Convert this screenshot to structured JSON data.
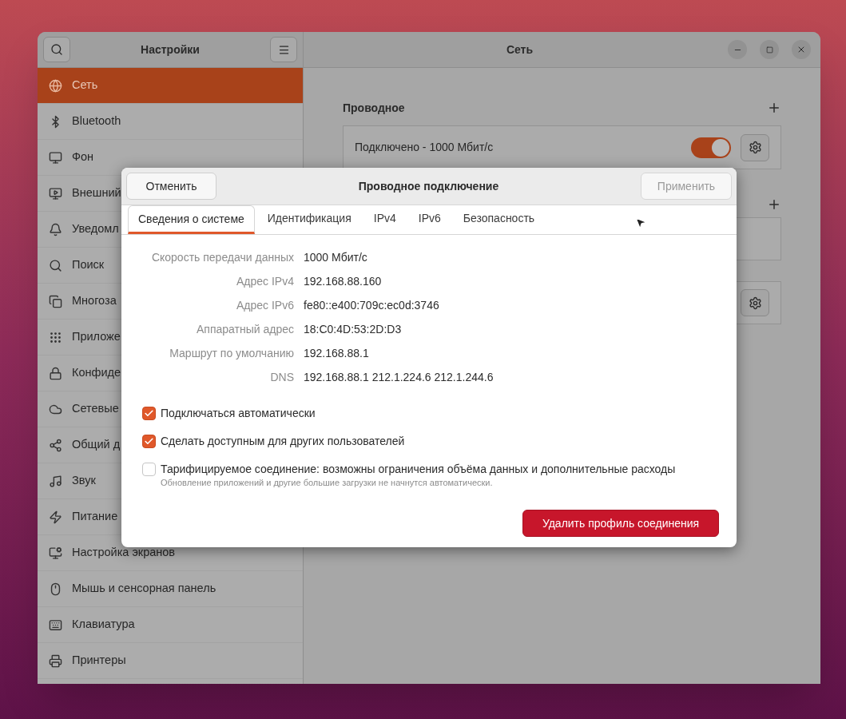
{
  "window": {
    "title": "Настройки",
    "panel_title": "Сеть"
  },
  "sidebar": {
    "items": [
      {
        "label": "Сеть",
        "selected": true
      },
      {
        "label": "Bluetooth",
        "selected": false
      },
      {
        "label": "Фон",
        "selected": false
      },
      {
        "label": "Внешний",
        "selected": false
      },
      {
        "label": "Уведомл",
        "selected": false
      },
      {
        "label": "Поиск",
        "selected": false
      },
      {
        "label": "Многоза",
        "selected": false
      },
      {
        "label": "Приложе",
        "selected": false
      },
      {
        "label": "Конфиде",
        "selected": false
      },
      {
        "label": "Сетевые",
        "selected": false
      },
      {
        "label": "Общий д",
        "selected": false
      },
      {
        "label": "Звук",
        "selected": false
      },
      {
        "label": "Питание",
        "selected": false
      },
      {
        "label": "Настройка экранов",
        "selected": false
      },
      {
        "label": "Мышь и сенсорная панель",
        "selected": false
      },
      {
        "label": "Клавиатура",
        "selected": false
      },
      {
        "label": "Принтеры",
        "selected": false
      }
    ]
  },
  "wired": {
    "heading": "Проводное",
    "connection": {
      "label": "Подключено - 1000 Мбит/с",
      "on": true
    }
  },
  "dialog": {
    "title": "Проводное подключение",
    "cancel": "Отменить",
    "apply": {
      "label": "Применить",
      "disabled": true
    },
    "tabs": [
      {
        "label": "Сведения о системе",
        "selected": true
      },
      {
        "label": "Идентификация",
        "selected": false
      },
      {
        "label": "IPv4",
        "selected": false
      },
      {
        "label": "IPv6",
        "selected": false
      },
      {
        "label": "Безопасность",
        "selected": false
      }
    ],
    "details": [
      {
        "label": "Скорость передачи данных",
        "value": "1000 Мбит/с"
      },
      {
        "label": "Адрес IPv4",
        "value": "192.168.88.160"
      },
      {
        "label": "Адрес IPv6",
        "value": "fe80::e400:709c:ec0d:3746"
      },
      {
        "label": "Аппаратный адрес",
        "value": "18:C0:4D:53:2D:D3"
      },
      {
        "label": "Маршрут по умолчанию",
        "value": "192.168.88.1"
      },
      {
        "label": "DNS",
        "value": "192.168.88.1 212.1.224.6 212.1.244.6"
      }
    ],
    "options": [
      {
        "label": "Подключаться автоматически",
        "checked": true
      },
      {
        "label": "Сделать доступным для других пользователей",
        "checked": true
      },
      {
        "label": "Тарифицируемое соединение: возможны ограничения объёма данных и дополнительные расходы",
        "note": "Обновление приложений и другие большие загрузки не начнутся автоматически.",
        "checked": false
      }
    ],
    "delete_button": "Удалить профиль соединения"
  }
}
